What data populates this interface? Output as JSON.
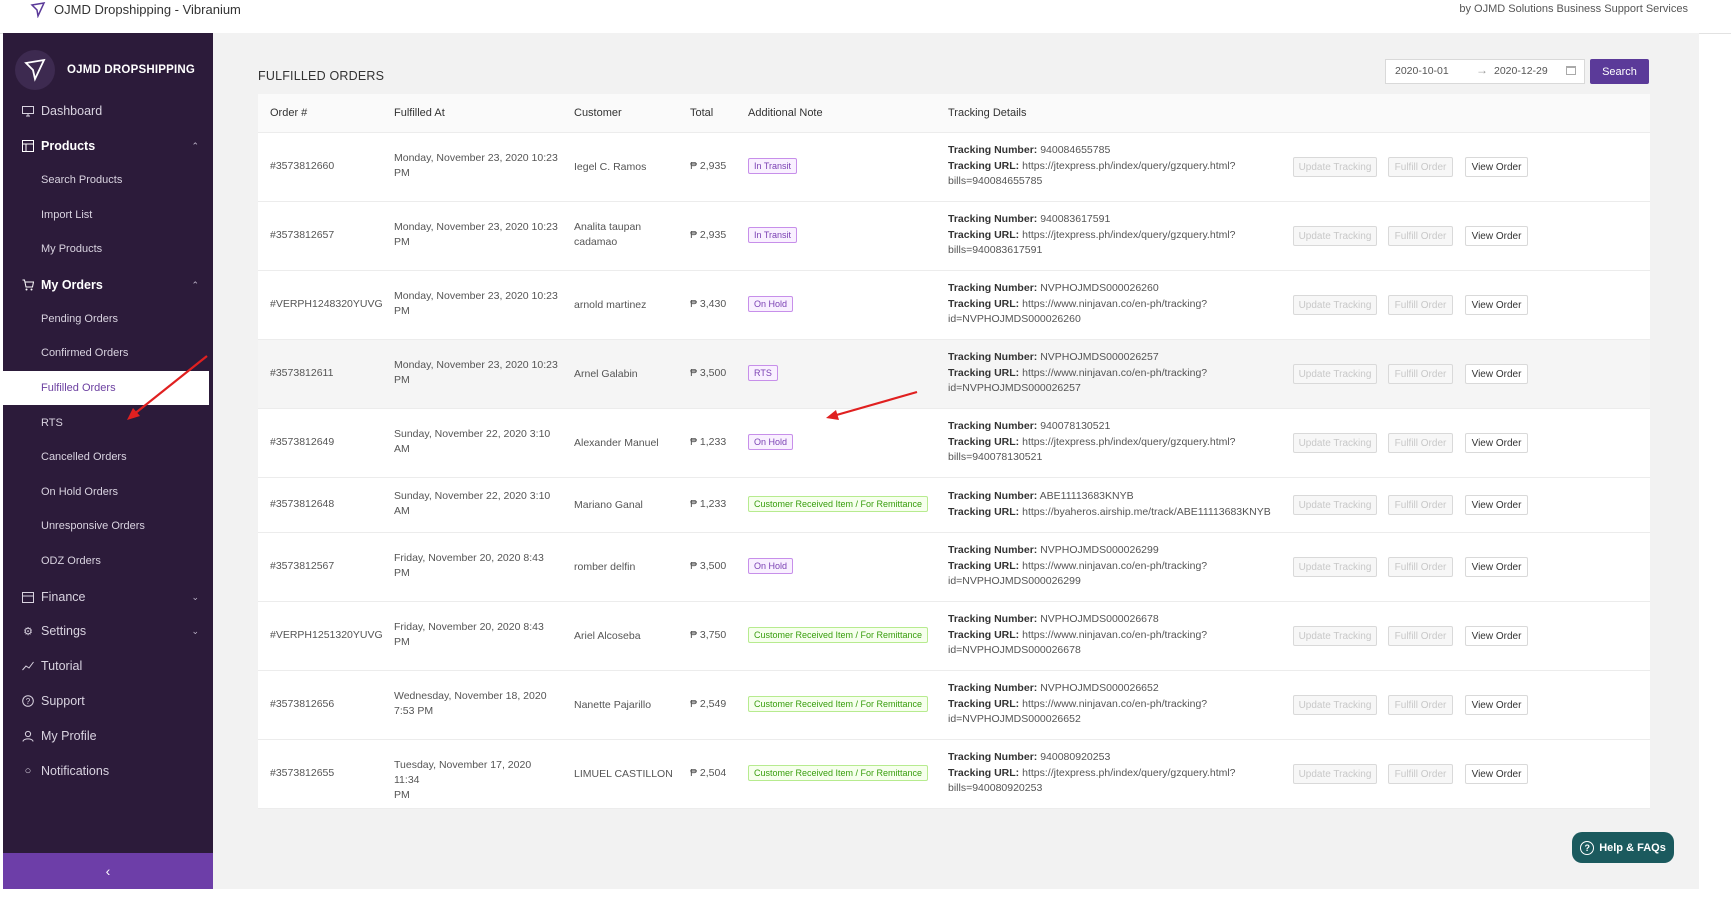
{
  "window": {
    "title": "OJMD Dropshipping - Vibranium",
    "by_text": "by OJMD Solutions Business Support Services"
  },
  "brand": {
    "name": "OJMD DROPSHIPPING"
  },
  "sidebar": {
    "items": [
      {
        "label": "Dashboard",
        "icon": "monitor-icon"
      },
      {
        "label": "Products",
        "icon": "box-icon"
      },
      {
        "label": "Search Products"
      },
      {
        "label": "Import List"
      },
      {
        "label": "My Products"
      },
      {
        "label": "My Orders",
        "icon": "cart-icon"
      },
      {
        "label": "Pending Orders"
      },
      {
        "label": "Confirmed Orders"
      },
      {
        "label": "Fulfilled Orders"
      },
      {
        "label": "RTS"
      },
      {
        "label": "Cancelled Orders"
      },
      {
        "label": "On Hold Orders"
      },
      {
        "label": "Unresponsive Orders"
      },
      {
        "label": "ODZ Orders"
      },
      {
        "label": "Finance",
        "icon": "wallet-icon"
      },
      {
        "label": "Settings",
        "icon": "gear-icon"
      },
      {
        "label": "Tutorial",
        "icon": "chart-line-icon"
      },
      {
        "label": "Support",
        "icon": "help-circle-icon"
      },
      {
        "label": "My Profile",
        "icon": "user-icon"
      },
      {
        "label": "Notifications",
        "icon": "bell-icon"
      }
    ],
    "active": "Fulfilled Orders",
    "collapse_icon": "chevron-left-icon"
  },
  "page": {
    "title": "FULFILLED ORDERS",
    "date_start": "2020-10-01",
    "date_end": "2020-12-29",
    "search_label": "Search"
  },
  "table": {
    "headers": [
      "Order #",
      "Fulfilled At",
      "Customer",
      "Total",
      "Additional Note",
      "Tracking Details"
    ],
    "tracking_number_label": "Tracking Number:",
    "tracking_url_label": "Tracking URL:",
    "actions": {
      "update": "Update Tracking",
      "fulfill": "Fulfill Order",
      "view": "View Order"
    },
    "rows": [
      {
        "order": "#3573812660",
        "date_l1": "Monday, November 23, 2020 10:23",
        "date_l2": "PM",
        "cust_l1": "Iegel C. Ramos",
        "cust_l2": "",
        "total": "₱ 2,935",
        "note": "In Transit",
        "tn": "940084655785",
        "url_l1": "https://jtexpress.ph/index/query/gzquery.html?",
        "url_l2": "bills=940084655785"
      },
      {
        "order": "#3573812657",
        "date_l1": "Monday, November 23, 2020 10:23",
        "date_l2": "PM",
        "cust_l1": "Analita taupan",
        "cust_l2": "cadamao",
        "total": "₱ 2,935",
        "note": "In Transit",
        "tn": "940083617591",
        "url_l1": "https://jtexpress.ph/index/query/gzquery.html?",
        "url_l2": "bills=940083617591"
      },
      {
        "order": "#VERPH1248320YUVG",
        "date_l1": "Monday, November 23, 2020 10:23",
        "date_l2": "PM",
        "cust_l1": "arnold martinez",
        "cust_l2": "",
        "total": "₱ 3,430",
        "note": "On Hold",
        "tn": "NVPHOJMDS000026260",
        "url_l1": "https://www.ninjavan.co/en-ph/tracking?",
        "url_l2": "id=NVPHOJMDS000026260"
      },
      {
        "order": "#3573812611",
        "date_l1": "Monday, November 23, 2020 10:23",
        "date_l2": "PM",
        "cust_l1": "Arnel Galabin",
        "cust_l2": "",
        "total": "₱ 3,500",
        "note": "RTS",
        "tn": "NVPHOJMDS000026257",
        "url_l1": "https://www.ninjavan.co/en-ph/tracking?",
        "url_l2": "id=NVPHOJMDS000026257"
      },
      {
        "order": "#3573812649",
        "date_l1": "Sunday, November 22, 2020 3:10",
        "date_l2": "AM",
        "cust_l1": "Alexander Manuel",
        "cust_l2": "",
        "total": "₱ 1,233",
        "note": "On Hold",
        "tn": "940078130521",
        "url_l1": "https://jtexpress.ph/index/query/gzquery.html?",
        "url_l2": "bills=940078130521"
      },
      {
        "order": "#3573812648",
        "date_l1": "Sunday, November 22, 2020 3:10",
        "date_l2": "AM",
        "cust_l1": "Mariano Ganal",
        "cust_l2": "",
        "total": "₱ 1,233",
        "note": "Customer Received Item / For Remittance",
        "tn": "ABE11113683KNYB",
        "url_l1": "https://byaheros.airship.me/track/ABE11113683KNYB",
        "url_l2": ""
      },
      {
        "order": "#3573812567",
        "date_l1": "Friday, November 20, 2020 8:43",
        "date_l2": "PM",
        "cust_l1": "romber delfin",
        "cust_l2": "",
        "total": "₱ 3,500",
        "note": "On Hold",
        "tn": "NVPHOJMDS000026299",
        "url_l1": "https://www.ninjavan.co/en-ph/tracking?",
        "url_l2": "id=NVPHOJMDS000026299"
      },
      {
        "order": "#VERPH1251320YUVG",
        "date_l1": "Friday, November 20, 2020 8:43",
        "date_l2": "PM",
        "cust_l1": "Ariel Alcoseba",
        "cust_l2": "",
        "total": "₱ 3,750",
        "note": "Customer Received Item / For Remittance",
        "tn": "NVPHOJMDS000026678",
        "url_l1": "https://www.ninjavan.co/en-ph/tracking?",
        "url_l2": "id=NVPHOJMDS000026678"
      },
      {
        "order": "#3573812656",
        "date_l1": "Wednesday, November 18, 2020",
        "date_l2": "7:53 PM",
        "cust_l1": "Nanette Pajarillo",
        "cust_l2": "",
        "total": "₱ 2,549",
        "note": "Customer Received Item / For Remittance",
        "tn": "NVPHOJMDS000026652",
        "url_l1": "https://www.ninjavan.co/en-ph/tracking?",
        "url_l2": "id=NVPHOJMDS000026652"
      },
      {
        "order": "#3573812655",
        "date_l1": "Tuesday, November 17, 2020 11:34",
        "date_l2": "PM",
        "cust_l1": "LIMUEL CASTILLON",
        "cust_l2": "",
        "total": "₱ 2,504",
        "note": "Customer Received Item / For Remittance",
        "tn": "940080920253",
        "url_l1": "https://jtexpress.ph/index/query/gzquery.html?",
        "url_l2": "bills=940080920253"
      }
    ]
  },
  "help": {
    "label": "Help & FAQs",
    "icon": "question-icon"
  },
  "colors": {
    "sidebar_bg": "#2c1b3a",
    "accent": "#5b3a99",
    "collapse_bar": "#6d3ea8",
    "help_bg": "#1b5a5e",
    "annotation_arrow": "#e02020"
  }
}
